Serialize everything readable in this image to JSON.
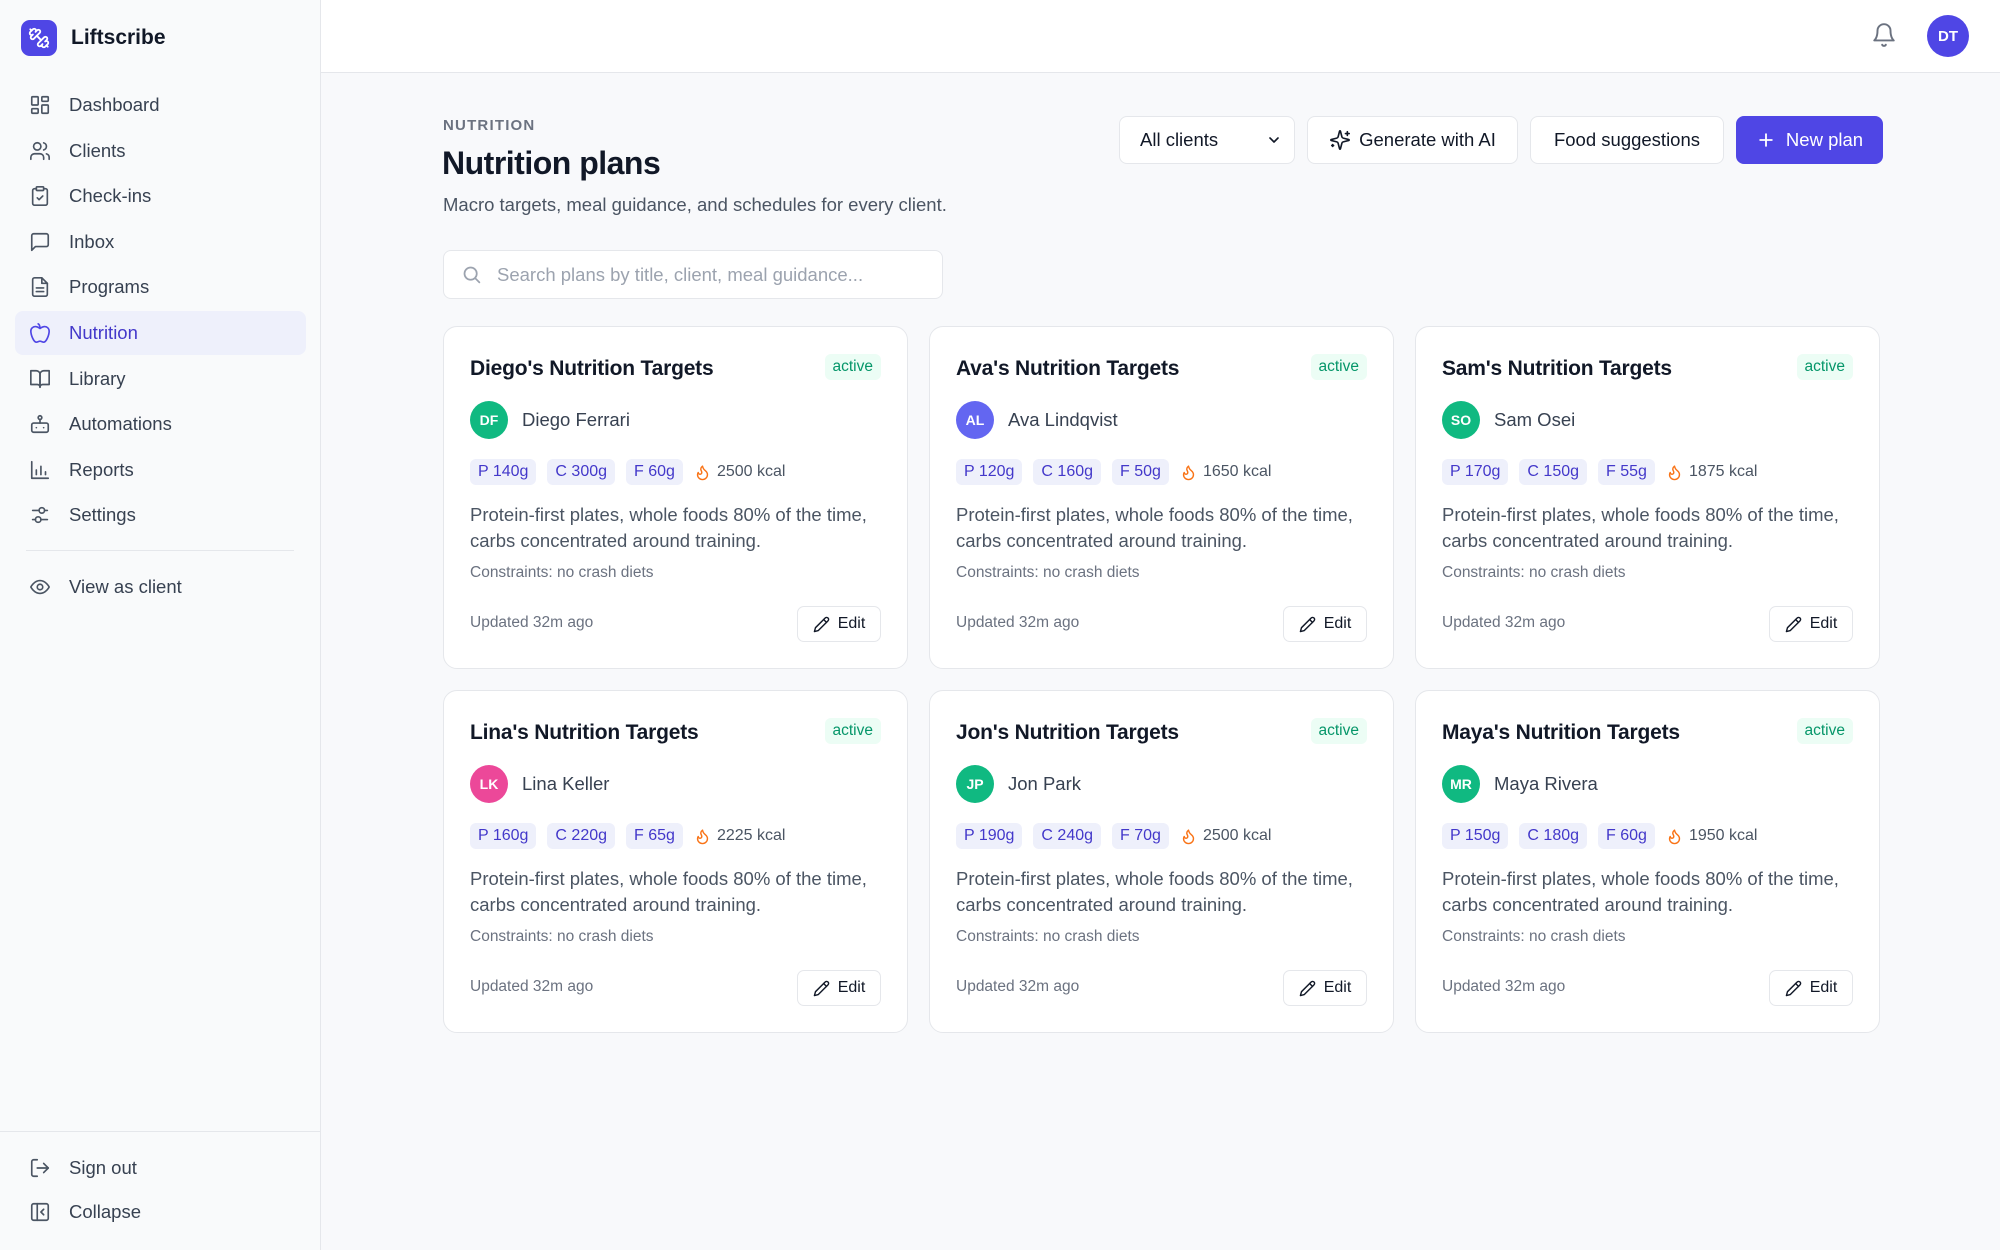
{
  "app": {
    "name": "Liftscribe"
  },
  "nav": {
    "items": [
      {
        "label": "Dashboard",
        "icon": "dashboard-icon"
      },
      {
        "label": "Clients",
        "icon": "users-icon"
      },
      {
        "label": "Check-ins",
        "icon": "clipboard-check-icon"
      },
      {
        "label": "Inbox",
        "icon": "message-icon"
      },
      {
        "label": "Programs",
        "icon": "file-text-icon"
      },
      {
        "label": "Nutrition",
        "icon": "apple-icon",
        "active": true
      },
      {
        "label": "Library",
        "icon": "book-icon"
      },
      {
        "label": "Automations",
        "icon": "bot-icon"
      },
      {
        "label": "Reports",
        "icon": "bar-chart-icon"
      },
      {
        "label": "Settings",
        "icon": "sliders-icon"
      }
    ],
    "view_as_client": "View as client",
    "sign_out": "Sign out",
    "collapse": "Collapse"
  },
  "topbar": {
    "user_initials": "DT"
  },
  "header": {
    "eyebrow": "NUTRITION",
    "title": "Nutrition plans",
    "subtitle": "Macro targets, meal guidance, and schedules for every client."
  },
  "actions": {
    "client_filter": "All clients",
    "generate_ai": "Generate with AI",
    "food_suggestions": "Food suggestions",
    "new_plan": "New plan"
  },
  "search": {
    "placeholder": "Search plans by title, client, meal guidance..."
  },
  "colors": {
    "accent": "#4f46e5",
    "active_badge": "#059669",
    "flame": "#f97316"
  },
  "plans": [
    {
      "title": "Diego's Nutrition Targets",
      "status": "active",
      "client": "Diego Ferrari",
      "initials": "DF",
      "avatar_color": "#10b981",
      "protein": "P 140g",
      "carbs": "C 300g",
      "fat": "F 60g",
      "kcal": "2500 kcal",
      "guidance": "Protein-first plates, whole foods 80% of the time, carbs concentrated around training.",
      "constraints": "Constraints: no crash diets",
      "updated": "Updated 32m ago",
      "edit": "Edit"
    },
    {
      "title": "Ava's Nutrition Targets",
      "status": "active",
      "client": "Ava Lindqvist",
      "initials": "AL",
      "avatar_color": "#6366f1",
      "protein": "P 120g",
      "carbs": "C 160g",
      "fat": "F 50g",
      "kcal": "1650 kcal",
      "guidance": "Protein-first plates, whole foods 80% of the time, carbs concentrated around training.",
      "constraints": "Constraints: no crash diets",
      "updated": "Updated 32m ago",
      "edit": "Edit"
    },
    {
      "title": "Sam's Nutrition Targets",
      "status": "active",
      "client": "Sam Osei",
      "initials": "SO",
      "avatar_color": "#10b981",
      "protein": "P 170g",
      "carbs": "C 150g",
      "fat": "F 55g",
      "kcal": "1875 kcal",
      "guidance": "Protein-first plates, whole foods 80% of the time, carbs concentrated around training.",
      "constraints": "Constraints: no crash diets",
      "updated": "Updated 32m ago",
      "edit": "Edit"
    },
    {
      "title": "Lina's Nutrition Targets",
      "status": "active",
      "client": "Lina Keller",
      "initials": "LK",
      "avatar_color": "#ec4899",
      "protein": "P 160g",
      "carbs": "C 220g",
      "fat": "F 65g",
      "kcal": "2225 kcal",
      "guidance": "Protein-first plates, whole foods 80% of the time, carbs concentrated around training.",
      "constraints": "Constraints: no crash diets",
      "updated": "Updated 32m ago",
      "edit": "Edit"
    },
    {
      "title": "Jon's Nutrition Targets",
      "status": "active",
      "client": "Jon Park",
      "initials": "JP",
      "avatar_color": "#10b981",
      "protein": "P 190g",
      "carbs": "C 240g",
      "fat": "F 70g",
      "kcal": "2500 kcal",
      "guidance": "Protein-first plates, whole foods 80% of the time, carbs concentrated around training.",
      "constraints": "Constraints: no crash diets",
      "updated": "Updated 32m ago",
      "edit": "Edit"
    },
    {
      "title": "Maya's Nutrition Targets",
      "status": "active",
      "client": "Maya Rivera",
      "initials": "MR",
      "avatar_color": "#10b981",
      "protein": "P 150g",
      "carbs": "C 180g",
      "fat": "F 60g",
      "kcal": "1950 kcal",
      "guidance": "Protein-first plates, whole foods 80% of the time, carbs concentrated around training.",
      "constraints": "Constraints: no crash diets",
      "updated": "Updated 32m ago",
      "edit": "Edit"
    }
  ]
}
